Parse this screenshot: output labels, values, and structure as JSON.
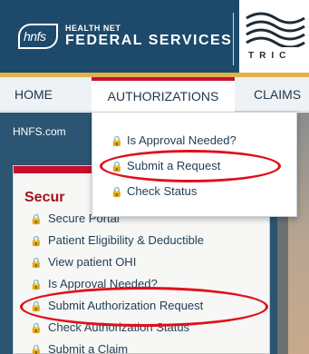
{
  "header": {
    "logo_text": "hnfs",
    "brand_sub": "HEALTH NET",
    "brand_main": "FEDERAL SERVICES",
    "tricare_text": "TRIC"
  },
  "nav": {
    "home": "HOME",
    "authorizations": "AUTHORIZATIONS",
    "claims": "CLAIMS"
  },
  "breadcrumb": "HNFS.com",
  "dropdown": {
    "items": [
      {
        "label": "Is Approval Needed?"
      },
      {
        "label": "Submit a Request"
      },
      {
        "label": "Check Status"
      }
    ]
  },
  "portal": {
    "title": "Secur",
    "items": [
      {
        "label": "Secure Portal"
      },
      {
        "label": "Patient Eligibility & Deductible"
      },
      {
        "label": "View patient OHI"
      },
      {
        "label": "Is Approval Needed?"
      },
      {
        "label": "Submit Authorization Request"
      },
      {
        "label": "Check Authorization Status"
      },
      {
        "label": "Submit a Claim"
      }
    ]
  },
  "colors": {
    "header_bg": "#1d4a6b",
    "accent_red": "#c8102e",
    "gold": "#e2b24b",
    "lock_icon": "#d79b12",
    "annotation": "#e0101c"
  },
  "icons": {
    "lock": "lock-icon"
  }
}
